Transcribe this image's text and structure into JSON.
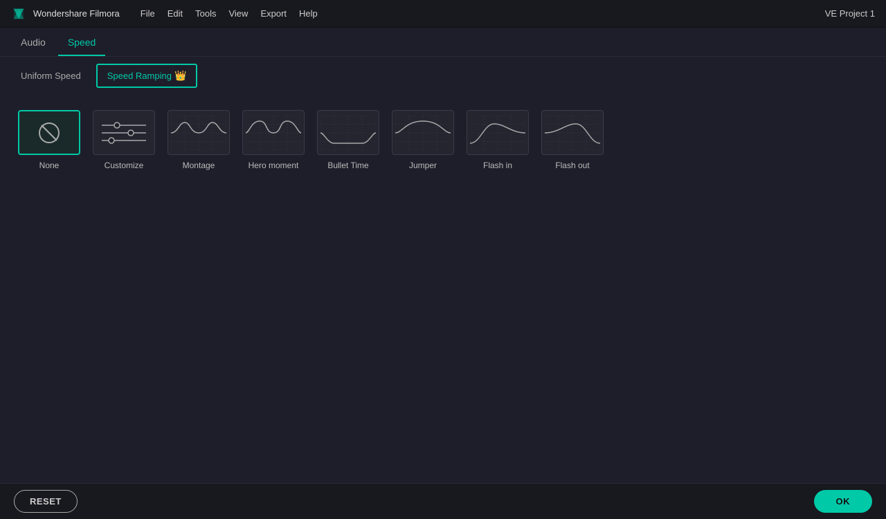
{
  "app": {
    "name": "Wondershare Filmora",
    "project": "VE Project 1"
  },
  "menu": {
    "items": [
      "File",
      "Edit",
      "Tools",
      "View",
      "Export",
      "Help"
    ]
  },
  "tabs": {
    "items": [
      {
        "id": "audio",
        "label": "Audio",
        "active": false
      },
      {
        "id": "speed",
        "label": "Speed",
        "active": true
      }
    ]
  },
  "subtabs": {
    "items": [
      {
        "id": "uniform",
        "label": "Uniform Speed",
        "active": false,
        "crown": false
      },
      {
        "id": "ramping",
        "label": "Speed Ramping",
        "active": true,
        "crown": true
      }
    ]
  },
  "presets": [
    {
      "id": "none",
      "label": "None",
      "type": "none",
      "selected": true
    },
    {
      "id": "customize",
      "label": "Customize",
      "type": "customize",
      "selected": false
    },
    {
      "id": "montage",
      "label": "Montage",
      "type": "montage",
      "selected": false
    },
    {
      "id": "hero",
      "label": "Hero moment",
      "type": "hero",
      "selected": false
    },
    {
      "id": "bullet",
      "label": "Bullet Time",
      "type": "bullet",
      "selected": false
    },
    {
      "id": "jumper",
      "label": "Jumper",
      "type": "jumper",
      "selected": false
    },
    {
      "id": "flashin",
      "label": "Flash in",
      "type": "flashin",
      "selected": false
    },
    {
      "id": "flashout",
      "label": "Flash out",
      "type": "flashout",
      "selected": false
    }
  ],
  "buttons": {
    "reset": "RESET",
    "ok": "OK"
  },
  "colors": {
    "accent": "#00c9a7",
    "bg": "#1e1e2a",
    "card_bg": "#252530",
    "border": "#3a3a4a"
  }
}
